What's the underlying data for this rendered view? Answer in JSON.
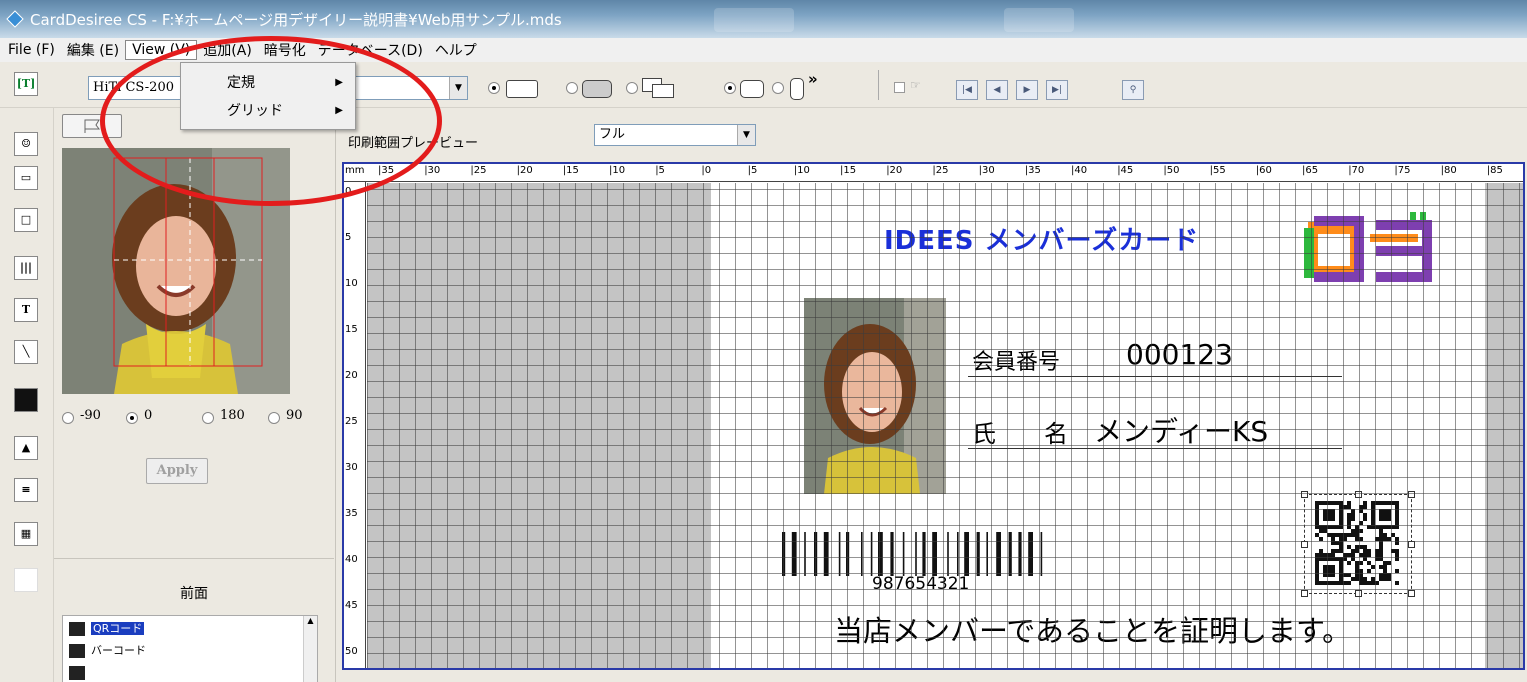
{
  "window": {
    "title": "CardDesiree CS - F:¥ホームページ用デザイリー説明書¥Web用サンプル.mds"
  },
  "menu": {
    "items": [
      {
        "label": "File (F)"
      },
      {
        "label": "編集 (E)"
      },
      {
        "label": "View (V)"
      },
      {
        "label": "追加(A)"
      },
      {
        "label": "暗号化"
      },
      {
        "label": "データベース(D)"
      },
      {
        "label": "ヘルプ"
      }
    ],
    "view_dropdown": [
      {
        "label": "定規",
        "submenu": true
      },
      {
        "label": "グリッド",
        "submenu": true
      }
    ]
  },
  "toolbar": {
    "printer_combo": "HiTi CS-200",
    "preview_label": "印刷範囲プレービュー",
    "preview_combo": "フル",
    "overflow_glyph": "»"
  },
  "photo_panel": {
    "rotation_options": [
      {
        "label": "-90",
        "selected": false
      },
      {
        "label": "0",
        "selected": true
      },
      {
        "label": "180",
        "selected": false
      },
      {
        "label": "90",
        "selected": false
      }
    ],
    "apply_label": "Apply",
    "side_label": "前面",
    "layers": [
      {
        "label": "QRコード",
        "selected": true
      },
      {
        "label": "バーコード",
        "selected": false
      }
    ]
  },
  "ruler": {
    "unit": "mm",
    "top_ticks": [
      "35",
      "30",
      "25",
      "20",
      "15",
      "10",
      "5",
      "0",
      "5",
      "10",
      "15",
      "20",
      "25",
      "30",
      "35",
      "40",
      "45",
      "50",
      "55",
      "60",
      "65",
      "70",
      "75",
      "80",
      "85"
    ],
    "left_ticks": [
      "0",
      "5",
      "10",
      "15",
      "20",
      "25",
      "30",
      "35",
      "40",
      "45",
      "50"
    ]
  },
  "card": {
    "title": "IDEES メンバーズカード",
    "logo_text": "ロゴ",
    "member_no_label": "会員番号",
    "member_no_value": "000123",
    "name_label": "氏　　名",
    "name_value": "メンディーKS",
    "barcode_number": "987654321",
    "footer": "当店メンバーであることを証明します。"
  },
  "colors": {
    "annotation": "#e31c1c",
    "card_title": "#1a2fd8",
    "selection": "#1a3dbf"
  }
}
